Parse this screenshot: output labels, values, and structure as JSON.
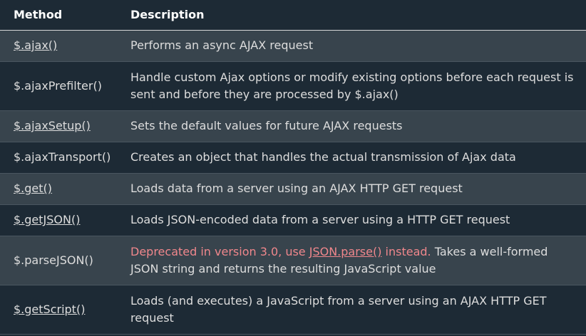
{
  "table": {
    "headers": {
      "method": "Method",
      "description": "Description"
    },
    "rows": [
      {
        "method": "$.ajax()",
        "description": "Performs an async AJAX request"
      },
      {
        "method": "$.ajaxPrefilter()",
        "description": "Handle custom Ajax options or modify existing options before each request is sent and before they are processed by $.ajax()"
      },
      {
        "method": "$.ajaxSetup()",
        "description": "Sets the default values for future AJAX requests"
      },
      {
        "method": "$.ajaxTransport()",
        "description": "Creates an object that handles the actual transmission of Ajax data"
      },
      {
        "method": "$.get()",
        "description": "Loads data from a server using an AJAX HTTP GET request"
      },
      {
        "method": "$.getJSON()",
        "description": "Loads JSON-encoded data from a server using a HTTP GET request"
      },
      {
        "method": "$.parseJSON()",
        "deprecated_prefix": "Deprecated in version 3.0, use ",
        "deprecated_link": "JSON.parse()",
        "deprecated_suffix": " instead.",
        "description": " Takes a well-formed JSON string and returns the resulting JavaScript value"
      },
      {
        "method": "$.getScript()",
        "description": "Loads (and executes) a JavaScript from a server using an AJAX HTTP GET request"
      }
    ]
  },
  "colors": {
    "background": "#1d2a35",
    "row_alt": "#38444d",
    "text": "#dddddd",
    "deprecated": "#f0878c"
  }
}
